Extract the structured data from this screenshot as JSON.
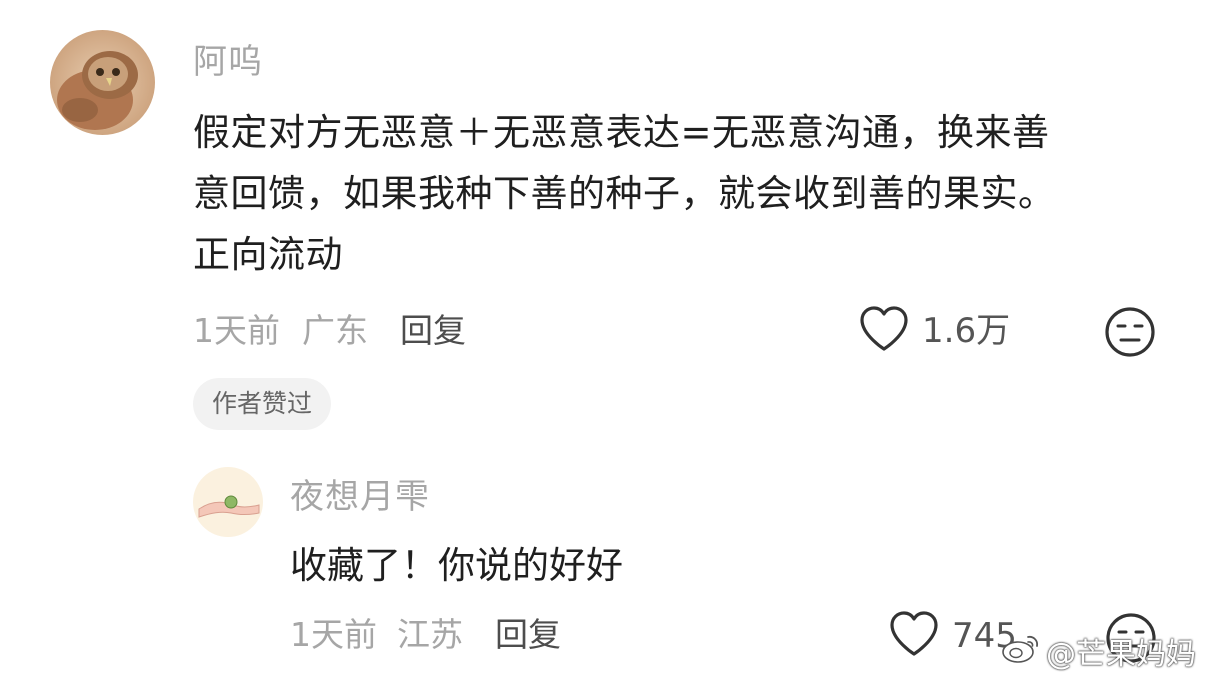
{
  "main_comment": {
    "username": "阿呜",
    "avatar_icon": "owl-avatar-icon",
    "body_lines": [
      "假定对方无恶意＋无恶意表达=无恶意沟通，换来善",
      "意回馈，如果我种下善的种子，就会收到善的果实。",
      "正向流动"
    ],
    "time": "1天前",
    "location": "广东",
    "reply_label": "回复",
    "like_count": "1.6万",
    "author_badge": "作者赞过"
  },
  "reply_comment": {
    "username": "夜想月雫",
    "avatar_icon": "hand-holding-ball-avatar-icon",
    "body": "收藏了！你说的好好",
    "time": "1天前",
    "location": "江苏",
    "reply_label": "回复",
    "like_count": "745"
  },
  "watermark": {
    "text": "@芒果妈妈",
    "icon": "weibo-logo-icon"
  },
  "colors": {
    "username": "#a6a6a6",
    "body": "#1f1f1f",
    "reply_link": "#4d4d4d",
    "badge_bg": "#f2f2f2"
  }
}
